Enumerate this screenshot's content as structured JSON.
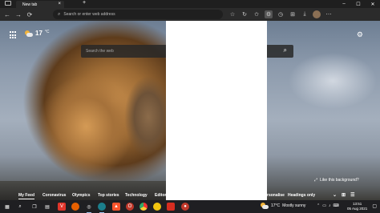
{
  "browser": {
    "tab_title": "New tab",
    "tab_close": "×",
    "new_tab": "+",
    "window_controls": [
      "–",
      "☐",
      "✕"
    ],
    "nav": {
      "back": "←",
      "forward": "→",
      "refresh": "⟳"
    },
    "address_placeholder": "Search or enter web address",
    "toolbar_icons": [
      "favorites-icon",
      "collections-icon",
      "extensions-icon",
      "downloads-icon",
      "history-icon",
      "settings-more-icon"
    ]
  },
  "newtab": {
    "weather": {
      "temp": "17",
      "unit": "°C"
    },
    "search_placeholder": "Search the web",
    "like_background": "Like this background?",
    "feed_tabs": [
      {
        "label": "My Feed",
        "selected": true
      },
      {
        "label": "Coronavirus",
        "selected": false
      },
      {
        "label": "Olympics",
        "selected": false
      },
      {
        "label": "Top stories",
        "selected": false
      },
      {
        "label": "Technology",
        "selected": false
      },
      {
        "label": "Editor",
        "selected": false
      },
      {
        "label": "rsonalise",
        "selected": false
      },
      {
        "label": "Headings only",
        "selected": false
      }
    ]
  },
  "taskbar": {
    "weather_temp": "17°C",
    "weather_desc": "Mostly sunny",
    "clock_time": "13:51",
    "clock_date": "05 Aug 2021"
  },
  "colors": {
    "accent_blue": "#4d9de0",
    "vivaldi_red": "#e0352b"
  }
}
